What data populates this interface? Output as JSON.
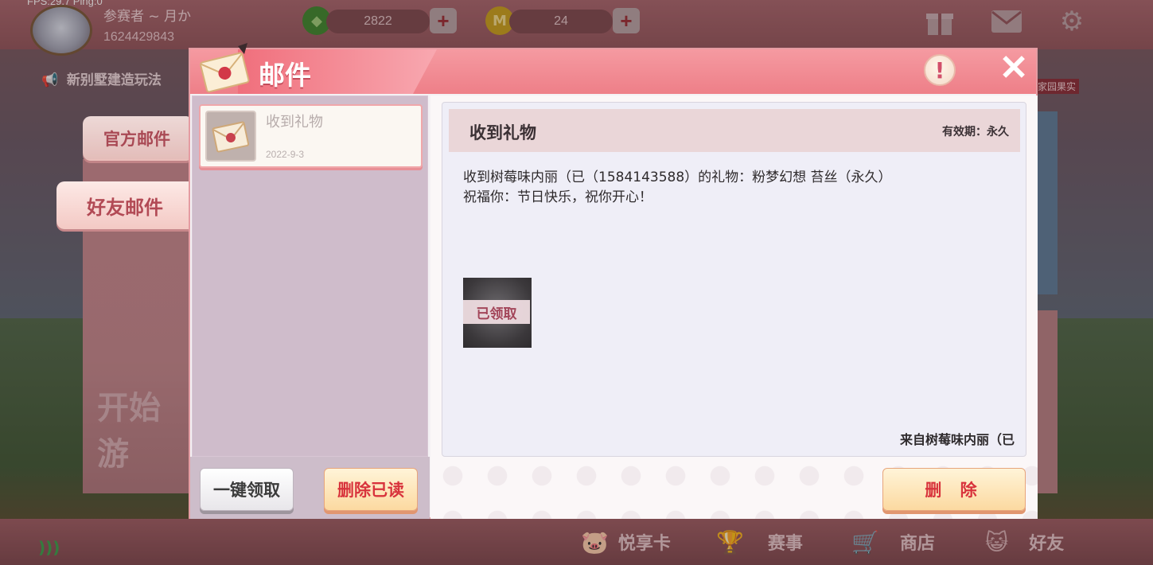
{
  "debug": {
    "fps_text": "FPS:29.7  Ping:0"
  },
  "player": {
    "name": "参赛者 ~ 月か",
    "id": "1624429843"
  },
  "currency": [
    {
      "value": "2822",
      "icon": "green-gem-icon",
      "color": "#3d8a2f"
    },
    {
      "value": "24",
      "icon": "gold-coin-icon",
      "color": "#c9a21d"
    }
  ],
  "top_icons": [
    "gift-icon",
    "mail-icon",
    "settings-gear-icon"
  ],
  "background": {
    "news_text": "新别墅建造玩法",
    "left_banner_text": "开始游",
    "home_badge": "家园果实"
  },
  "side_tabs": {
    "official_mail": "官方邮件",
    "friend_mail": "好友邮件"
  },
  "dialog": {
    "title": "邮件",
    "info_symbol": "!",
    "close_symbol": "✕"
  },
  "mail_list": [
    {
      "subject": "收到礼物",
      "date": "2022-9-3",
      "icon": "envelope-seal-icon"
    }
  ],
  "list_buttons": {
    "claim_all": "一键领取",
    "delete_read": "删除已读"
  },
  "mail_detail": {
    "title": "收到礼物",
    "validity": "有效期：永久",
    "body_line1": "收到树莓味内丽（已（1584143588）的礼物：粉梦幻想 苔丝（永久）",
    "body_line2": "祝福你：节日快乐，祝你开心！",
    "attachment_status": "已领取",
    "from": "来自树莓味内丽（已",
    "delete_button": "删 除"
  },
  "bottom_nav": [
    {
      "label": "悦享卡",
      "icon": "piggy-card-icon"
    },
    {
      "label": "赛事",
      "icon": "trophy-icon"
    },
    {
      "label": "商店",
      "icon": "shop-cart-icon"
    },
    {
      "label": "好友",
      "icon": "friend-face-icon"
    }
  ],
  "colors": {
    "accent_pink": "#ee7f88",
    "button_red_text": "#d8333c",
    "status_label": "#a3465a"
  }
}
